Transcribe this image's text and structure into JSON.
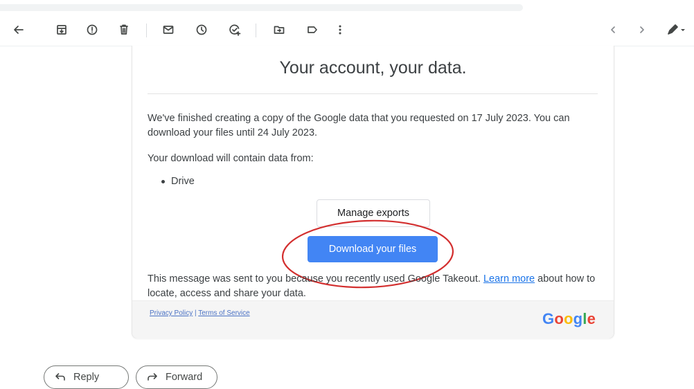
{
  "email": {
    "title": "Your account, your data.",
    "para1": "We've finished creating a copy of the Google data that you requested on 17 July 2023. You can download your files until 24 July 2023.",
    "para2": "Your download will contain data from:",
    "bullet": "Drive",
    "manage_label": "Manage exports",
    "download_label": "Download your files",
    "notice_pre": "This message was sent to you because you recently used Google Takeout. ",
    "learn_more": "Learn more",
    "notice_post": " about how to locate, access and share your data."
  },
  "footer": {
    "privacy": "Privacy Policy",
    "divider": " | ",
    "terms": "Terms of Service",
    "logo_letters": [
      {
        "ch": "G",
        "color": "#4285f4"
      },
      {
        "ch": "o",
        "color": "#ea4335"
      },
      {
        "ch": "o",
        "color": "#fbbc05"
      },
      {
        "ch": "g",
        "color": "#4285f4"
      },
      {
        "ch": "l",
        "color": "#34a853"
      },
      {
        "ch": "e",
        "color": "#ea4335"
      }
    ]
  },
  "actions": {
    "reply": "Reply",
    "forward": "Forward"
  },
  "colors": {
    "accent": "#4285f4",
    "annotation": "#d32f2f"
  },
  "icons": [
    "back-arrow-icon",
    "archive-icon",
    "report-spam-icon",
    "delete-icon",
    "mark-unread-icon",
    "snooze-icon",
    "add-task-icon",
    "move-to-icon",
    "label-icon",
    "more-vert-icon",
    "prev-icon",
    "next-icon",
    "pen-icon"
  ]
}
